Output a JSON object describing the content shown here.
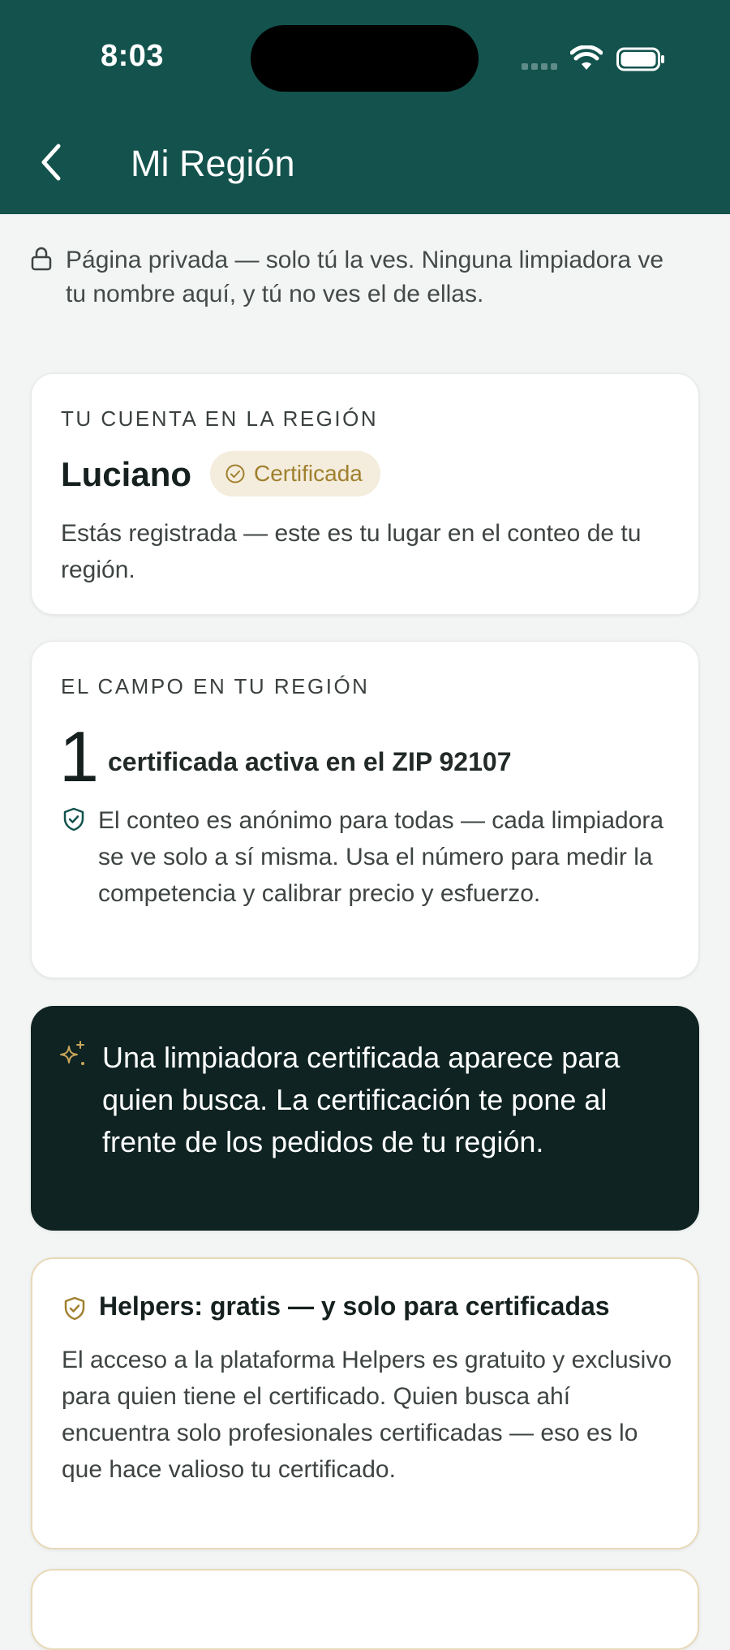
{
  "status_bar": {
    "time": "8:03"
  },
  "header": {
    "title": "Mi Región"
  },
  "privacy_note": "Página privada — solo tú la ves. Ninguna limpiadora ve tu nombre aquí, y tú no ves el de ellas.",
  "account_card": {
    "eyebrow": "TU CUENTA EN LA REGIÓN",
    "name": "Luciano",
    "badge": "Certificada",
    "body": "Estás registrada — este es tu lugar en el conteo de tu región."
  },
  "field_card": {
    "eyebrow": "EL CAMPO EN TU REGIÓN",
    "count": "1",
    "count_label": "certificada activa en el ZIP 92107",
    "note": "El conteo es anónimo para todas — cada limpiadora se ve solo a sí misma. Usa el número para medir la competencia y calibrar precio y esfuerzo."
  },
  "promo_card": {
    "text": "Una limpiadora certificada aparece para quien busca. La certificación te pone al frente de los pedidos de tu región."
  },
  "helpers_card": {
    "title": "Helpers: gratis — y solo para certificadas",
    "body": "El acceso a la plataforma Helpers es gratuito y exclusivo para quien tiene el certificado. Quien busca ahí encuentra solo profesionales certificadas — eso es lo que hace valioso tu certificado."
  },
  "colors": {
    "header_bg": "#13524d",
    "accent_gold": "#a0802f",
    "dark_card_bg": "#0e2322"
  }
}
